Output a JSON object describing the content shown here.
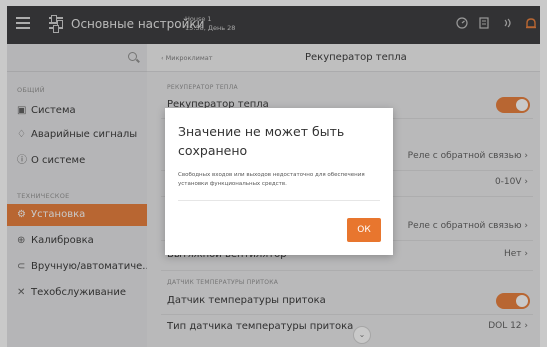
{
  "topbar": {
    "title": "Основные настройки",
    "house_name": "House 1",
    "datetime": "15:58, День 28",
    "icons": [
      "menu-icon",
      "sliders-icon",
      "gauge-icon",
      "document-icon",
      "signal-icon",
      "alarm-icon"
    ]
  },
  "sidebar": {
    "search_icon": "search-icon",
    "section_general": "ОБЩИЙ",
    "section_technical": "ТЕХНИЧЕСКОЕ",
    "items": [
      {
        "label": "Система",
        "icon": "system-icon"
      },
      {
        "label": "Аварийные сигналы",
        "icon": "bell-icon"
      },
      {
        "label": "О системе",
        "icon": "info-icon"
      },
      {
        "label": "Установка",
        "icon": "installation-icon",
        "active": true
      },
      {
        "label": "Калибровка",
        "icon": "calibration-icon"
      },
      {
        "label": "Вручную/автоматиче...",
        "icon": "manual-auto-icon"
      },
      {
        "label": "Техобслуживание",
        "icon": "wrench-icon"
      }
    ]
  },
  "main": {
    "breadcrumb": "‹ Микроклимат",
    "title": "Рекуператор тепла",
    "section_recuperator": "РЕКУПЕРАТОР ТЕПЛА",
    "row_recuperator_label": "Рекуператор тепла",
    "row_feedback_value_1": "Реле с обратной связью ›",
    "row_voltage_value": "0-10V ›",
    "row_feedback_value_2": "Реле с обратной связью ›",
    "row_fan_label": "Вытяжной вентилятор",
    "row_fan_value": "Нет ›",
    "section_supply": "ДАТЧИК ТЕМПЕРАТУРЫ ПРИТОКА",
    "row_sensor_label": "Датчик температуры притока",
    "row_sensor_type_label": "Тип датчика температуры притока",
    "row_sensor_type_value": "DOL 12 ›",
    "toggles": {
      "recuperator": true,
      "supply_sensor": true
    },
    "accent_color": "#e8762e"
  },
  "modal": {
    "title": "Значение не может быть сохранено",
    "message": "Свободных входов или выходов недостаточно для обеспечения установки функциональных средств.",
    "ok_label": "ОК"
  }
}
